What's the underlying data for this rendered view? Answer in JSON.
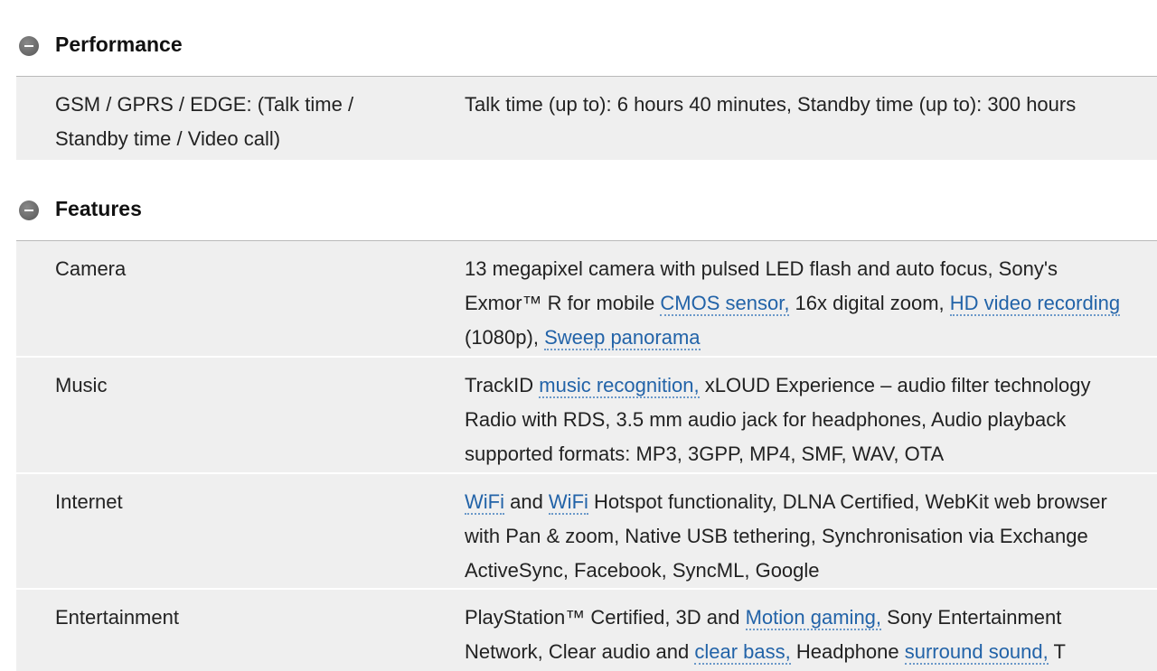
{
  "performance": {
    "title": "Performance",
    "rows": [
      {
        "label_lines": [
          "GSM / GPRS / EDGE: (Talk time /",
          "Standby time / Video call)"
        ],
        "value_lines": [
          "Talk time (up to): 6 hours 40 minutes, Standby time (up to): 300 hours"
        ]
      }
    ]
  },
  "features": {
    "title": "Features",
    "camera": {
      "label": "Camera",
      "l1": "13 megapixel camera with pulsed LED flash and auto focus, Sony's",
      "l2_a": "Exmor™ R for mobile ",
      "l2_link1": "CMOS sensor,",
      "l2_b": " 16x digital zoom, ",
      "l2_link2": "HD video recording",
      "l3_a": "(1080p), ",
      "l3_link": "Sweep panorama"
    },
    "music": {
      "label": "Music",
      "l1_a": "TrackID ",
      "l1_link": "music recognition,",
      "l1_b": " xLOUD Experience – audio filter technology",
      "l2": "Radio with RDS, 3.5 mm audio jack for headphones, Audio playback",
      "l3": "supported formats: MP3, 3GPP, MP4, SMF, WAV, OTA"
    },
    "internet": {
      "label": "Internet",
      "l1_link1": "WiFi",
      "l1_a": " and ",
      "l1_link2": "WiFi",
      "l1_b": " Hotspot functionality, DLNA Certified, WebKit web browser",
      "l2": "with Pan & zoom, Native USB tethering, Synchronisation via Exchange",
      "l3": "ActiveSync, Facebook, SyncML, Google"
    },
    "entertainment": {
      "label": "Entertainment",
      "l1_a": "PlayStation™ Certified, 3D and ",
      "l1_link": "Motion gaming,",
      "l1_b": " Sony Entertainment",
      "l2_a": "Network, Clear audio and ",
      "l2_link1": "clear bass,",
      "l2_b": " Headphone ",
      "l2_link2": "surround sound,",
      "l2_c": " T"
    }
  },
  "colors": {
    "row_bg": "#efefef",
    "link": "#2263a8",
    "rule": "#b9b9b9"
  }
}
